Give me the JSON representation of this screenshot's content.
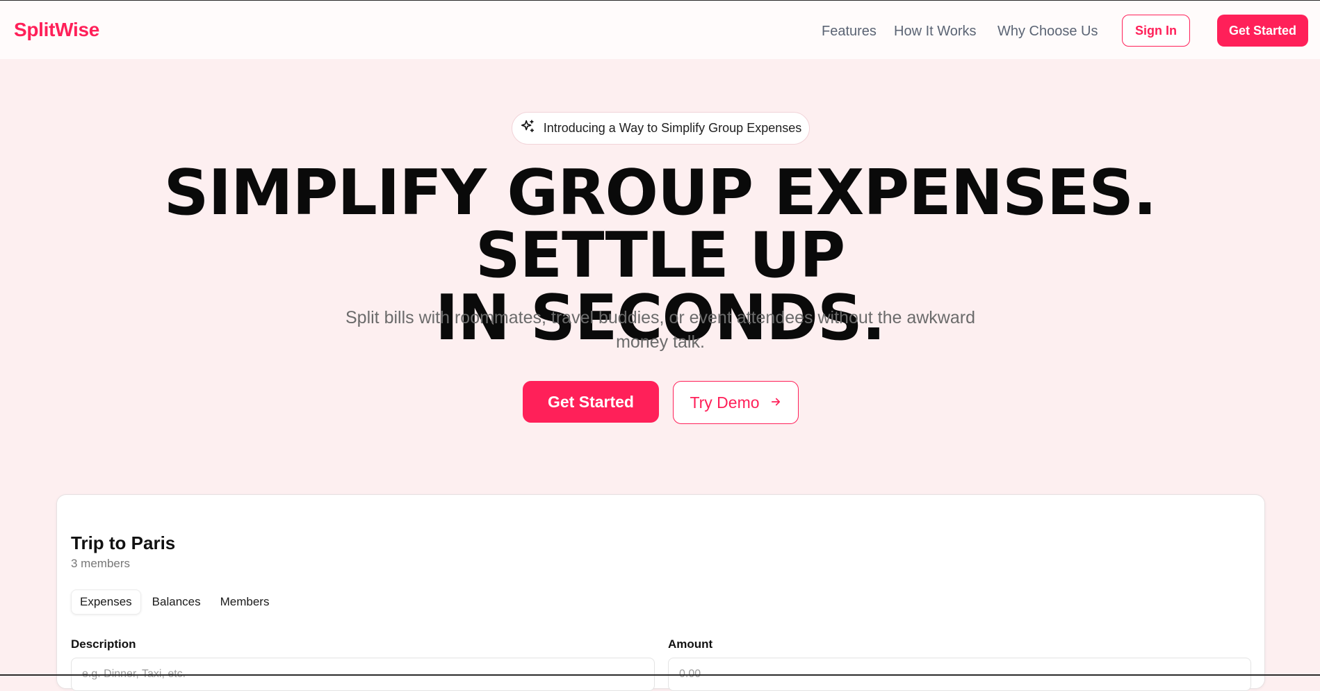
{
  "brand": {
    "name": "SplitWise",
    "accent": "#ff2059"
  },
  "nav": {
    "links": [
      "Features",
      "How It Works",
      "Why Choose Us"
    ],
    "sign_in": "Sign In",
    "get_started": "Get Started"
  },
  "hero": {
    "badge_icon": "sparkles-icon",
    "badge_text": "Introducing a Way to Simplify Group Expenses",
    "headline_line1": "SIMPLIFY GROUP EXPENSES. SETTLE UP",
    "headline_line2": "IN SECONDS.",
    "subtitle_line1": "Split bills with roommates, travel buddies, or event attendees without the awkward",
    "subtitle_line2": "money talk.",
    "primary_cta": "Get Started",
    "secondary_cta": "Try Demo",
    "secondary_cta_icon": "arrow-right-icon"
  },
  "demo": {
    "group_name": "Trip to Paris",
    "members_count": "3 members",
    "tabs": [
      {
        "label": "Expenses",
        "active": true
      },
      {
        "label": "Balances",
        "active": false
      },
      {
        "label": "Members",
        "active": false
      }
    ],
    "description_label": "Description",
    "description_placeholder": "e.g. Dinner, Taxi, etc.",
    "amount_label": "Amount",
    "amount_placeholder": "0.00"
  }
}
